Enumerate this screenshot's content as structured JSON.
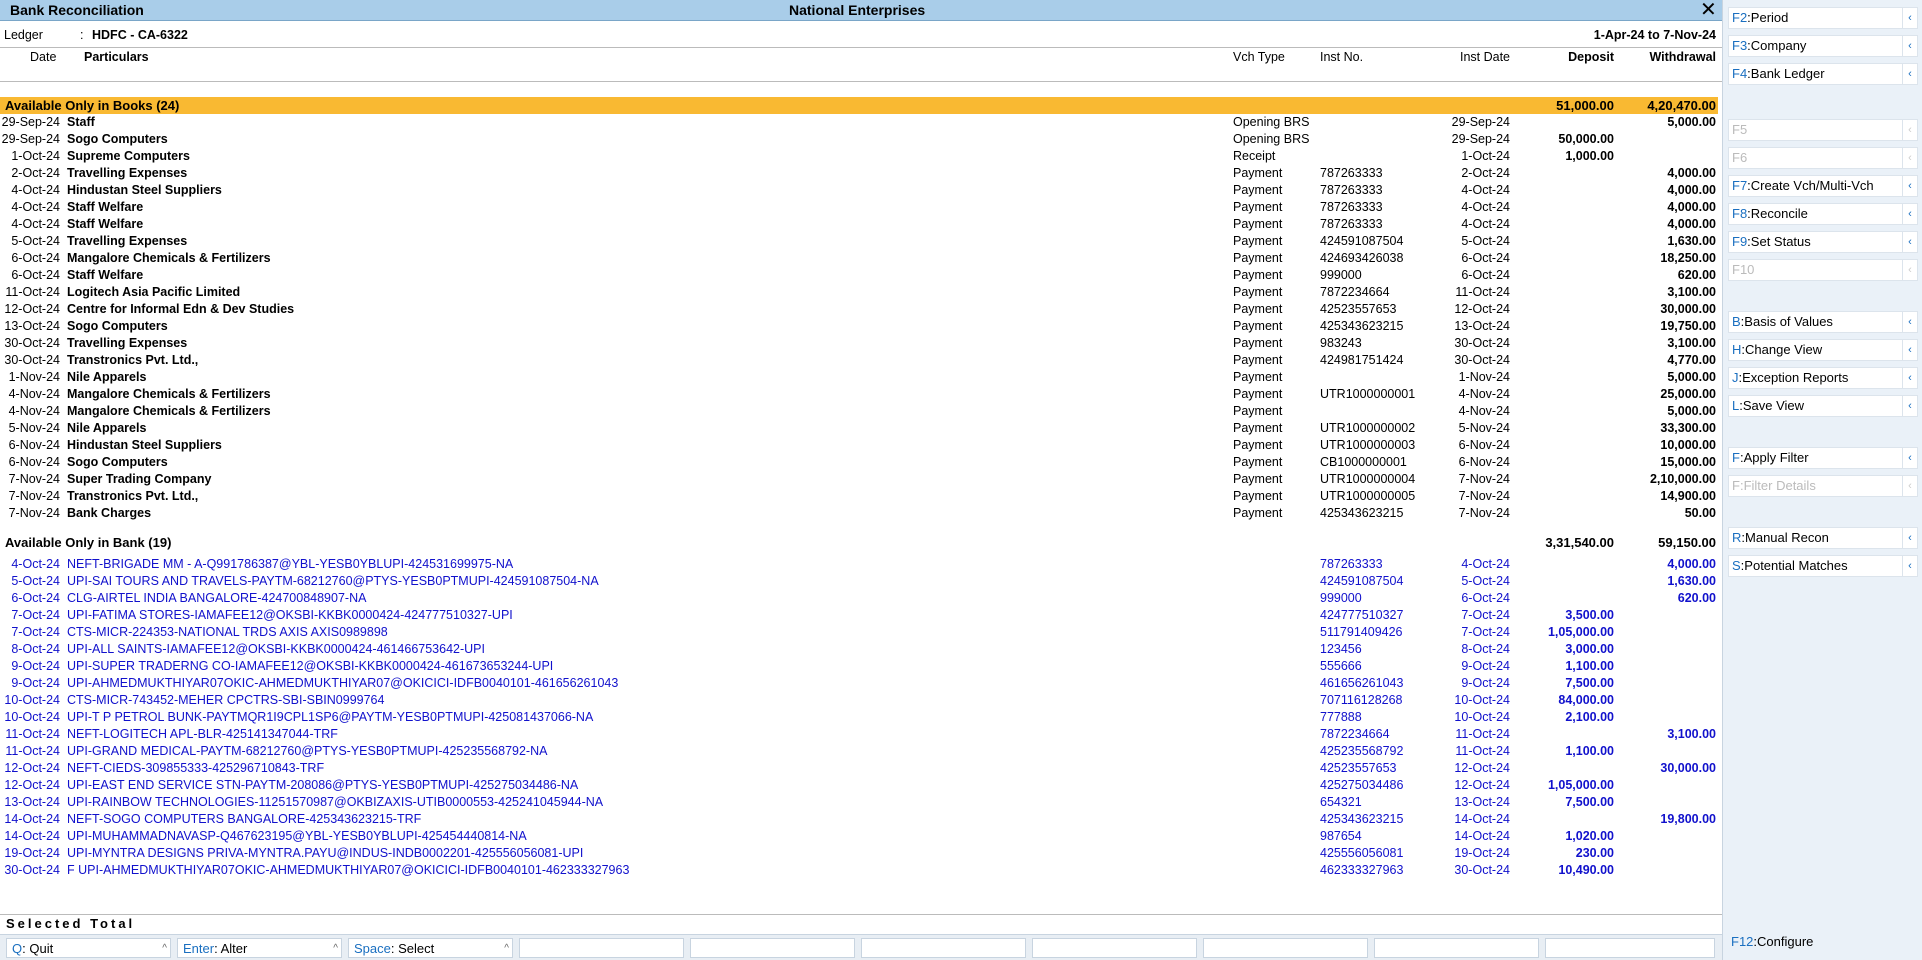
{
  "window": {
    "title": "Bank Reconciliation",
    "company": "National Enterprises"
  },
  "header": {
    "ledger_label": "Ledger",
    "ledger_sep": ":",
    "ledger_value": "HDFC - CA-6322",
    "period": "1-Apr-24 to 7-Nov-24"
  },
  "columns": {
    "date": "Date",
    "particulars": "Particulars",
    "vch_type": "Vch Type",
    "inst_no": "Inst No.",
    "inst_date": "Inst Date",
    "deposit": "Deposit",
    "withdrawal": "Withdrawal"
  },
  "books_section": {
    "title": "Available Only in Books (24)",
    "deposit": "51,000.00",
    "withdrawal": "4,20,470.00"
  },
  "books_rows": [
    {
      "date": "29-Sep-24",
      "particulars": "Staff",
      "vch_type": "Opening BRS",
      "inst_no": "",
      "inst_date": "29-Sep-24",
      "deposit": "",
      "withdrawal": "5,000.00"
    },
    {
      "date": "29-Sep-24",
      "particulars": "Sogo Computers",
      "vch_type": "Opening BRS",
      "inst_no": "",
      "inst_date": "29-Sep-24",
      "deposit": "50,000.00",
      "withdrawal": ""
    },
    {
      "date": "1-Oct-24",
      "particulars": "Supreme Computers",
      "vch_type": "Receipt",
      "inst_no": "",
      "inst_date": "1-Oct-24",
      "deposit": "1,000.00",
      "withdrawal": ""
    },
    {
      "date": "2-Oct-24",
      "particulars": "Travelling Expenses",
      "vch_type": "Payment",
      "inst_no": "787263333",
      "inst_date": "2-Oct-24",
      "deposit": "",
      "withdrawal": "4,000.00"
    },
    {
      "date": "4-Oct-24",
      "particulars": "Hindustan Steel Suppliers",
      "vch_type": "Payment",
      "inst_no": "787263333",
      "inst_date": "4-Oct-24",
      "deposit": "",
      "withdrawal": "4,000.00"
    },
    {
      "date": "4-Oct-24",
      "particulars": "Staff Welfare",
      "vch_type": "Payment",
      "inst_no": "787263333",
      "inst_date": "4-Oct-24",
      "deposit": "",
      "withdrawal": "4,000.00"
    },
    {
      "date": "4-Oct-24",
      "particulars": "Staff Welfare",
      "vch_type": "Payment",
      "inst_no": "787263333",
      "inst_date": "4-Oct-24",
      "deposit": "",
      "withdrawal": "4,000.00"
    },
    {
      "date": "5-Oct-24",
      "particulars": "Travelling Expenses",
      "vch_type": "Payment",
      "inst_no": "424591087504",
      "inst_date": "5-Oct-24",
      "deposit": "",
      "withdrawal": "1,630.00"
    },
    {
      "date": "6-Oct-24",
      "particulars": "Mangalore Chemicals & Fertilizers",
      "vch_type": "Payment",
      "inst_no": "424693426038",
      "inst_date": "6-Oct-24",
      "deposit": "",
      "withdrawal": "18,250.00"
    },
    {
      "date": "6-Oct-24",
      "particulars": "Staff Welfare",
      "vch_type": "Payment",
      "inst_no": "999000",
      "inst_date": "6-Oct-24",
      "deposit": "",
      "withdrawal": "620.00"
    },
    {
      "date": "11-Oct-24",
      "particulars": "Logitech Asia Pacific Limited",
      "vch_type": "Payment",
      "inst_no": "7872234664",
      "inst_date": "11-Oct-24",
      "deposit": "",
      "withdrawal": "3,100.00"
    },
    {
      "date": "12-Oct-24",
      "particulars": "Centre for Informal Edn & Dev Studies",
      "vch_type": "Payment",
      "inst_no": "42523557653",
      "inst_date": "12-Oct-24",
      "deposit": "",
      "withdrawal": "30,000.00"
    },
    {
      "date": "13-Oct-24",
      "particulars": "Sogo Computers",
      "vch_type": "Payment",
      "inst_no": "425343623215",
      "inst_date": "13-Oct-24",
      "deposit": "",
      "withdrawal": "19,750.00"
    },
    {
      "date": "30-Oct-24",
      "particulars": "Travelling Expenses",
      "vch_type": "Payment",
      "inst_no": "983243",
      "inst_date": "30-Oct-24",
      "deposit": "",
      "withdrawal": "3,100.00"
    },
    {
      "date": "30-Oct-24",
      "particulars": "Transtronics Pvt. Ltd.,",
      "vch_type": "Payment",
      "inst_no": "424981751424",
      "inst_date": "30-Oct-24",
      "deposit": "",
      "withdrawal": "4,770.00"
    },
    {
      "date": "1-Nov-24",
      "particulars": "Nile Apparels",
      "vch_type": "Payment",
      "inst_no": "",
      "inst_date": "1-Nov-24",
      "deposit": "",
      "withdrawal": "5,000.00"
    },
    {
      "date": "4-Nov-24",
      "particulars": "Mangalore Chemicals & Fertilizers",
      "vch_type": "Payment",
      "inst_no": "UTR1000000001",
      "inst_date": "4-Nov-24",
      "deposit": "",
      "withdrawal": "25,000.00"
    },
    {
      "date": "4-Nov-24",
      "particulars": "Mangalore Chemicals & Fertilizers",
      "vch_type": "Payment",
      "inst_no": "",
      "inst_date": "4-Nov-24",
      "deposit": "",
      "withdrawal": "5,000.00"
    },
    {
      "date": "5-Nov-24",
      "particulars": "Nile Apparels",
      "vch_type": "Payment",
      "inst_no": "UTR1000000002",
      "inst_date": "5-Nov-24",
      "deposit": "",
      "withdrawal": "33,300.00"
    },
    {
      "date": "6-Nov-24",
      "particulars": "Hindustan Steel Suppliers",
      "vch_type": "Payment",
      "inst_no": "UTR1000000003",
      "inst_date": "6-Nov-24",
      "deposit": "",
      "withdrawal": "10,000.00"
    },
    {
      "date": "6-Nov-24",
      "particulars": "Sogo Computers",
      "vch_type": "Payment",
      "inst_no": "CB1000000001",
      "inst_date": "6-Nov-24",
      "deposit": "",
      "withdrawal": "15,000.00"
    },
    {
      "date": "7-Nov-24",
      "particulars": "Super Trading Company",
      "vch_type": "Payment",
      "inst_no": "UTR1000000004",
      "inst_date": "7-Nov-24",
      "deposit": "",
      "withdrawal": "2,10,000.00"
    },
    {
      "date": "7-Nov-24",
      "particulars": "Transtronics Pvt. Ltd.,",
      "vch_type": "Payment",
      "inst_no": "UTR1000000005",
      "inst_date": "7-Nov-24",
      "deposit": "",
      "withdrawal": "14,900.00"
    },
    {
      "date": "7-Nov-24",
      "particulars": "Bank Charges",
      "vch_type": "Payment",
      "inst_no": "425343623215",
      "inst_date": "7-Nov-24",
      "deposit": "",
      "withdrawal": "50.00"
    }
  ],
  "bank_section": {
    "title": "Available Only in Bank (19)",
    "deposit": "3,31,540.00",
    "withdrawal": "59,150.00"
  },
  "bank_rows": [
    {
      "date": "4-Oct-24",
      "particulars": "NEFT-BRIGADE MM - A-Q991786387@YBL-YESB0YBLUPI-424531699975-NA",
      "inst_no": "787263333",
      "inst_date": "4-Oct-24",
      "deposit": "",
      "withdrawal": "4,000.00"
    },
    {
      "date": "5-Oct-24",
      "particulars": "UPI-SAI TOURS AND TRAVELS-PAYTM-68212760@PTYS-YESB0PTMUPI-424591087504-NA",
      "inst_no": "424591087504",
      "inst_date": "5-Oct-24",
      "deposit": "",
      "withdrawal": "1,630.00"
    },
    {
      "date": "6-Oct-24",
      "particulars": "CLG-AIRTEL INDIA BANGALORE-424700848907-NA",
      "inst_no": "999000",
      "inst_date": "6-Oct-24",
      "deposit": "",
      "withdrawal": "620.00"
    },
    {
      "date": "7-Oct-24",
      "particulars": "UPI-FATIMA STORES-IAMAFEE12@OKSBI-KKBK0000424-424777510327-UPI",
      "inst_no": "424777510327",
      "inst_date": "7-Oct-24",
      "deposit": "3,500.00",
      "withdrawal": ""
    },
    {
      "date": "7-Oct-24",
      "particulars": "CTS-MICR-224353-NATIONAL TRDS AXIS AXIS0989898",
      "inst_no": "511791409426",
      "inst_date": "7-Oct-24",
      "deposit": "1,05,000.00",
      "withdrawal": ""
    },
    {
      "date": "8-Oct-24",
      "particulars": "UPI-ALL SAINTS-IAMAFEE12@OKSBI-KKBK0000424-461466753642-UPI",
      "inst_no": "123456",
      "inst_date": "8-Oct-24",
      "deposit": "3,000.00",
      "withdrawal": ""
    },
    {
      "date": "9-Oct-24",
      "particulars": "UPI-SUPER TRADERNG CO-IAMAFEE12@OKSBI-KKBK0000424-461673653244-UPI",
      "inst_no": "555666",
      "inst_date": "9-Oct-24",
      "deposit": "1,100.00",
      "withdrawal": ""
    },
    {
      "date": "9-Oct-24",
      "particulars": "UPI-AHMEDMUKTHIYAR07OKIC-AHMEDMUKTHIYAR07@OKICICI-IDFB0040101-461656261043",
      "inst_no": "461656261043",
      "inst_date": "9-Oct-24",
      "deposit": "7,500.00",
      "withdrawal": ""
    },
    {
      "date": "10-Oct-24",
      "particulars": "CTS-MICR-743452-MEHER CPCTRS-SBI-SBIN0999764",
      "inst_no": "707116128268",
      "inst_date": "10-Oct-24",
      "deposit": "84,000.00",
      "withdrawal": ""
    },
    {
      "date": "10-Oct-24",
      "particulars": "UPI-T P PETROL BUNK-PAYTMQR1I9CPL1SP6@PAYTM-YESB0PTMUPI-425081437066-NA",
      "inst_no": "777888",
      "inst_date": "10-Oct-24",
      "deposit": "2,100.00",
      "withdrawal": ""
    },
    {
      "date": "11-Oct-24",
      "particulars": "NEFT-LOGITECH APL-BLR-425141347044-TRF",
      "inst_no": "7872234664",
      "inst_date": "11-Oct-24",
      "deposit": "",
      "withdrawal": "3,100.00"
    },
    {
      "date": "11-Oct-24",
      "particulars": "UPI-GRAND MEDICAL-PAYTM-68212760@PTYS-YESB0PTMUPI-425235568792-NA",
      "inst_no": "425235568792",
      "inst_date": "11-Oct-24",
      "deposit": "1,100.00",
      "withdrawal": ""
    },
    {
      "date": "12-Oct-24",
      "particulars": "NEFT-CIEDS-309855333-425296710843-TRF",
      "inst_no": "42523557653",
      "inst_date": "12-Oct-24",
      "deposit": "",
      "withdrawal": "30,000.00"
    },
    {
      "date": "12-Oct-24",
      "particulars": "UPI-EAST END SERVICE STN-PAYTM-208086@PTYS-YESB0PTMUPI-425275034486-NA",
      "inst_no": "425275034486",
      "inst_date": "12-Oct-24",
      "deposit": "1,05,000.00",
      "withdrawal": ""
    },
    {
      "date": "13-Oct-24",
      "particulars": "UPI-RAINBOW TECHNOLOGIES-11251570987@OKBIZAXIS-UTIB0000553-425241045944-NA",
      "inst_no": "654321",
      "inst_date": "13-Oct-24",
      "deposit": "7,500.00",
      "withdrawal": ""
    },
    {
      "date": "14-Oct-24",
      "particulars": "NEFT-SOGO COMPUTERS BANGALORE-425343623215-TRF",
      "inst_no": "425343623215",
      "inst_date": "14-Oct-24",
      "deposit": "",
      "withdrawal": "19,800.00"
    },
    {
      "date": "14-Oct-24",
      "particulars": "UPI-MUHAMMADNAVASP-Q467623195@YBL-YESB0YBLUPI-425454440814-NA",
      "inst_no": "987654",
      "inst_date": "14-Oct-24",
      "deposit": "1,020.00",
      "withdrawal": ""
    },
    {
      "date": "19-Oct-24",
      "particulars": "UPI-MYNTRA DESIGNS PRIVA-MYNTRA.PAYU@INDUS-INDB0002201-425556056081-UPI",
      "inst_no": "425556056081",
      "inst_date": "19-Oct-24",
      "deposit": "230.00",
      "withdrawal": ""
    },
    {
      "date": "30-Oct-24",
      "particulars": "F UPI-AHMEDMUKTHIYAR07OKIC-AHMEDMUKTHIYAR07@OKICICI-IDFB0040101-462333327963",
      "inst_no": "462333327963",
      "inst_date": "30-Oct-24",
      "deposit": "10,490.00",
      "withdrawal": ""
    }
  ],
  "footer": {
    "selected_total": "Selected Total"
  },
  "bottom_buttons": [
    {
      "key": "Q",
      "label": "Quit"
    },
    {
      "key": "Enter",
      "label": "Alter"
    },
    {
      "key": "Space",
      "label": "Select"
    }
  ],
  "side_buttons": [
    {
      "key": "F2",
      "label": "Period",
      "enabled": true
    },
    {
      "key": "F3",
      "label": "Company",
      "enabled": true
    },
    {
      "key": "F4",
      "label": "Bank Ledger",
      "enabled": true
    },
    {
      "key": "F5",
      "label": "",
      "enabled": false
    },
    {
      "key": "F6",
      "label": "",
      "enabled": false
    },
    {
      "key": "F7",
      "label": "Create Vch/Multi-Vch",
      "enabled": true
    },
    {
      "key": "F8",
      "label": "Reconcile",
      "enabled": true
    },
    {
      "key": "F9",
      "label": "Set Status",
      "enabled": true
    },
    {
      "key": "F10",
      "label": "",
      "enabled": false
    },
    {
      "key": "B",
      "label": "Basis of Values",
      "enabled": true
    },
    {
      "key": "H",
      "label": "Change View",
      "enabled": true
    },
    {
      "key": "J",
      "label": "Exception Reports",
      "enabled": true
    },
    {
      "key": "L",
      "label": "Save View",
      "enabled": true
    },
    {
      "key": "F",
      "label": "Apply Filter",
      "enabled": true
    },
    {
      "key": "F",
      "label": "Filter Details",
      "enabled": false
    },
    {
      "key": "R",
      "label": "Manual Recon",
      "enabled": true
    },
    {
      "key": "S",
      "label": "Potential Matches",
      "enabled": true
    },
    {
      "key": "F12",
      "label": "Configure",
      "enabled": true
    }
  ]
}
